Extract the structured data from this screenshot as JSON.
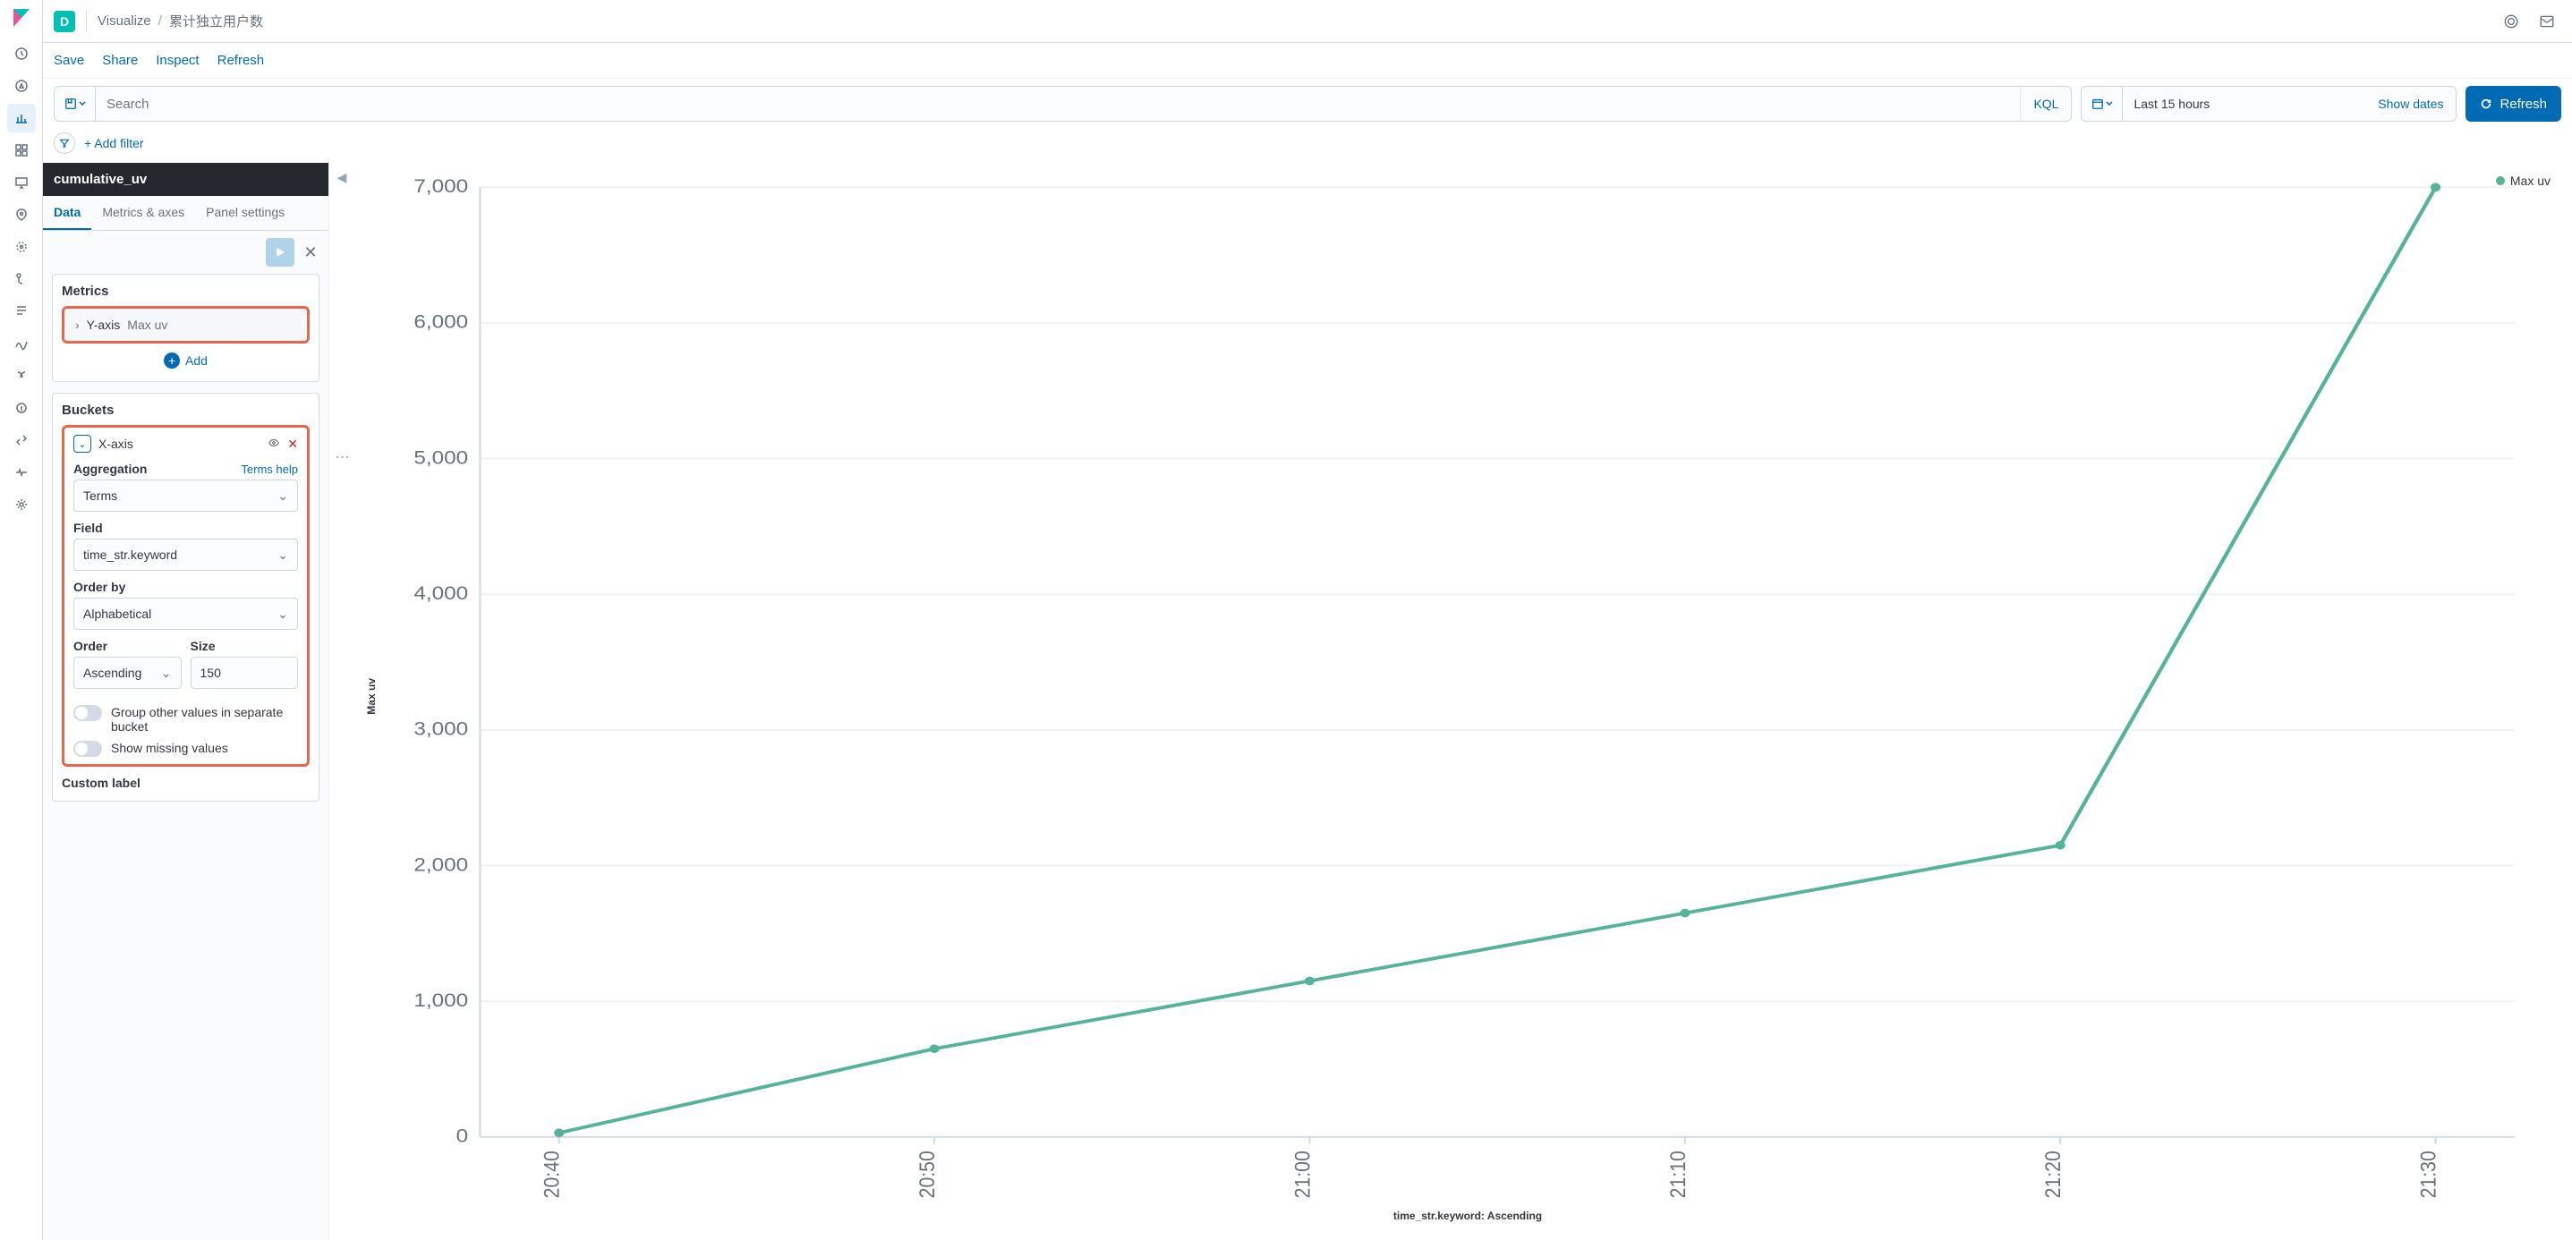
{
  "header": {
    "space_initial": "D",
    "breadcrumb_app": "Visualize",
    "breadcrumb_title": "累计独立用户数"
  },
  "actions": {
    "save": "Save",
    "share": "Share",
    "inspect": "Inspect",
    "refresh_top": "Refresh"
  },
  "query": {
    "search_placeholder": "Search",
    "kql_label": "KQL",
    "date_text": "Last 15 hours",
    "show_dates": "Show dates",
    "refresh": "Refresh"
  },
  "filter": {
    "add_filter": "+ Add filter"
  },
  "editor": {
    "title": "cumulative_uv",
    "tabs": {
      "data": "Data",
      "metrics_axes": "Metrics & axes",
      "panel": "Panel settings"
    },
    "metrics": {
      "heading": "Metrics",
      "yaxis_label": "Y-axis",
      "yaxis_value": "Max uv",
      "add": "Add"
    },
    "buckets": {
      "heading": "Buckets",
      "xaxis_label": "X-axis",
      "aggregation_label": "Aggregation",
      "terms_help": "Terms help",
      "aggregation_value": "Terms",
      "field_label": "Field",
      "field_value": "time_str.keyword",
      "orderby_label": "Order by",
      "orderby_value": "Alphabetical",
      "order_label": "Order",
      "order_value": "Ascending",
      "size_label": "Size",
      "size_value": "150",
      "group_other": "Group other values in separate bucket",
      "show_missing": "Show missing values",
      "custom_label": "Custom label"
    }
  },
  "chart_data": {
    "type": "line",
    "title": "",
    "ylabel": "Max uv",
    "xlabel": "time_str.keyword: Ascending",
    "legend": "Max uv",
    "categories": [
      "20:40",
      "20:50",
      "21:00",
      "21:10",
      "21:20",
      "21:30"
    ],
    "values": [
      30,
      650,
      1150,
      1650,
      2150,
      7000
    ],
    "ylim": [
      0,
      7000
    ],
    "yticks": [
      0,
      1000,
      2000,
      3000,
      4000,
      5000,
      6000,
      7000
    ]
  }
}
